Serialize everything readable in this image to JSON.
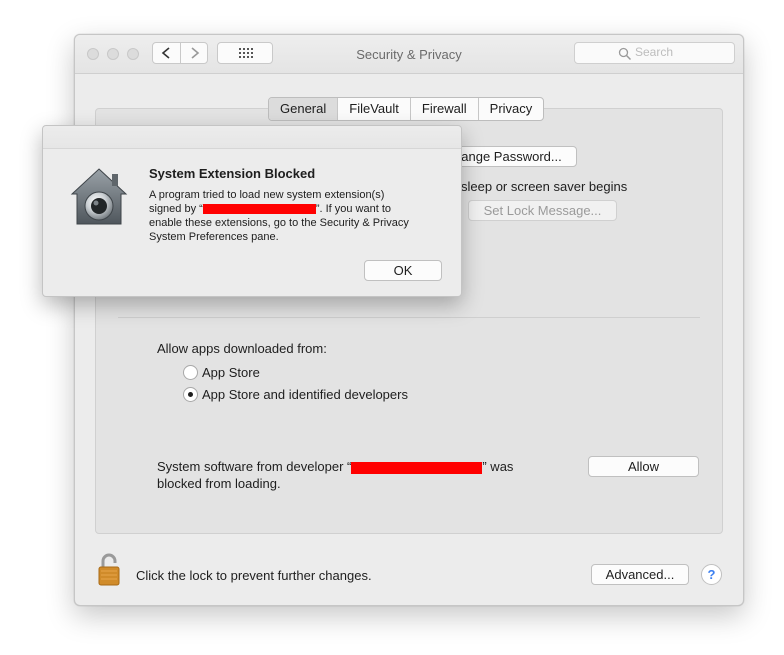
{
  "window": {
    "title": "Security & Privacy",
    "search_placeholder": "Search"
  },
  "tabs": [
    {
      "label": "General",
      "selected": true
    },
    {
      "label": "FileVault",
      "selected": false
    },
    {
      "label": "Firewall",
      "selected": false
    },
    {
      "label": "Privacy",
      "selected": false
    }
  ],
  "general": {
    "change_password_label": "ange Password...",
    "sleep_text": "sleep or screen saver begins",
    "set_lock_message_label": "Set Lock Message...",
    "allow_from_heading": "Allow apps downloaded from:",
    "radio_options": [
      {
        "label": "App Store",
        "checked": false
      },
      {
        "label": "App Store and identified developers",
        "checked": true
      }
    ],
    "blocked_prefix": "System software from developer “",
    "blocked_suffix": "” was",
    "blocked_line2": "blocked from loading.",
    "allow_label": "Allow"
  },
  "footer": {
    "lock_text": "Click the lock to prevent further changes.",
    "advanced_label": "Advanced...",
    "help_label": "?"
  },
  "dialog": {
    "title": "System Extension Blocked",
    "line1": "A program tried to load new system extension(s)",
    "line2_prefix": "signed by “",
    "line2_suffix": "”.  If you want to",
    "line3": "enable these extensions, go to the Security & Privacy",
    "line4": "System Preferences pane.",
    "ok_label": "OK"
  },
  "colors": {
    "redaction": "#ff0000",
    "help_accent": "#3b7ff0"
  }
}
